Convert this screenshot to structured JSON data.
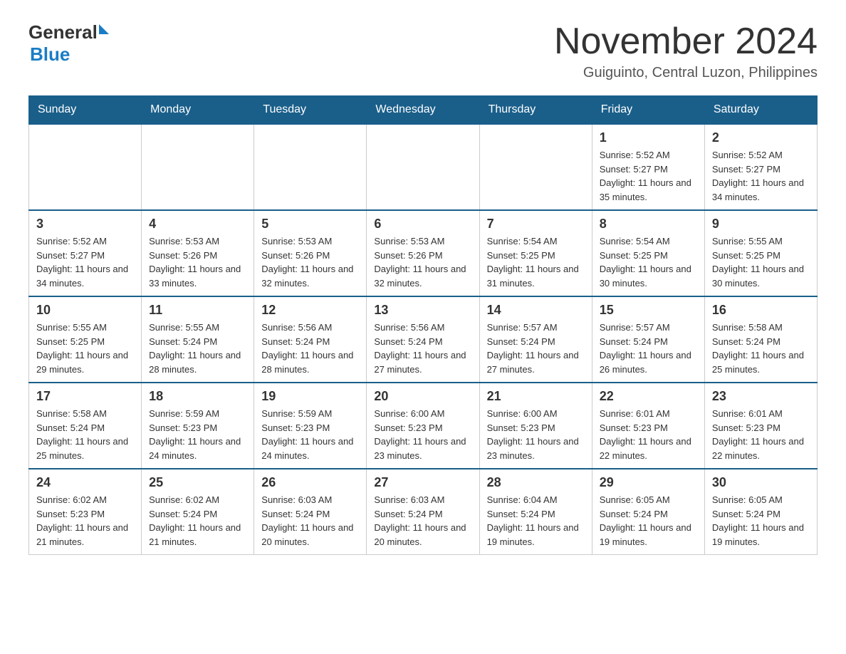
{
  "header": {
    "logo": {
      "general": "General",
      "blue": "Blue",
      "alt": "GeneralBlue logo"
    },
    "title": "November 2024",
    "location": "Guiguinto, Central Luzon, Philippines"
  },
  "calendar": {
    "days_of_week": [
      "Sunday",
      "Monday",
      "Tuesday",
      "Wednesday",
      "Thursday",
      "Friday",
      "Saturday"
    ],
    "weeks": [
      [
        {
          "day": "",
          "info": ""
        },
        {
          "day": "",
          "info": ""
        },
        {
          "day": "",
          "info": ""
        },
        {
          "day": "",
          "info": ""
        },
        {
          "day": "",
          "info": ""
        },
        {
          "day": "1",
          "info": "Sunrise: 5:52 AM\nSunset: 5:27 PM\nDaylight: 11 hours and 35 minutes."
        },
        {
          "day": "2",
          "info": "Sunrise: 5:52 AM\nSunset: 5:27 PM\nDaylight: 11 hours and 34 minutes."
        }
      ],
      [
        {
          "day": "3",
          "info": "Sunrise: 5:52 AM\nSunset: 5:27 PM\nDaylight: 11 hours and 34 minutes."
        },
        {
          "day": "4",
          "info": "Sunrise: 5:53 AM\nSunset: 5:26 PM\nDaylight: 11 hours and 33 minutes."
        },
        {
          "day": "5",
          "info": "Sunrise: 5:53 AM\nSunset: 5:26 PM\nDaylight: 11 hours and 32 minutes."
        },
        {
          "day": "6",
          "info": "Sunrise: 5:53 AM\nSunset: 5:26 PM\nDaylight: 11 hours and 32 minutes."
        },
        {
          "day": "7",
          "info": "Sunrise: 5:54 AM\nSunset: 5:25 PM\nDaylight: 11 hours and 31 minutes."
        },
        {
          "day": "8",
          "info": "Sunrise: 5:54 AM\nSunset: 5:25 PM\nDaylight: 11 hours and 30 minutes."
        },
        {
          "day": "9",
          "info": "Sunrise: 5:55 AM\nSunset: 5:25 PM\nDaylight: 11 hours and 30 minutes."
        }
      ],
      [
        {
          "day": "10",
          "info": "Sunrise: 5:55 AM\nSunset: 5:25 PM\nDaylight: 11 hours and 29 minutes."
        },
        {
          "day": "11",
          "info": "Sunrise: 5:55 AM\nSunset: 5:24 PM\nDaylight: 11 hours and 28 minutes."
        },
        {
          "day": "12",
          "info": "Sunrise: 5:56 AM\nSunset: 5:24 PM\nDaylight: 11 hours and 28 minutes."
        },
        {
          "day": "13",
          "info": "Sunrise: 5:56 AM\nSunset: 5:24 PM\nDaylight: 11 hours and 27 minutes."
        },
        {
          "day": "14",
          "info": "Sunrise: 5:57 AM\nSunset: 5:24 PM\nDaylight: 11 hours and 27 minutes."
        },
        {
          "day": "15",
          "info": "Sunrise: 5:57 AM\nSunset: 5:24 PM\nDaylight: 11 hours and 26 minutes."
        },
        {
          "day": "16",
          "info": "Sunrise: 5:58 AM\nSunset: 5:24 PM\nDaylight: 11 hours and 25 minutes."
        }
      ],
      [
        {
          "day": "17",
          "info": "Sunrise: 5:58 AM\nSunset: 5:24 PM\nDaylight: 11 hours and 25 minutes."
        },
        {
          "day": "18",
          "info": "Sunrise: 5:59 AM\nSunset: 5:23 PM\nDaylight: 11 hours and 24 minutes."
        },
        {
          "day": "19",
          "info": "Sunrise: 5:59 AM\nSunset: 5:23 PM\nDaylight: 11 hours and 24 minutes."
        },
        {
          "day": "20",
          "info": "Sunrise: 6:00 AM\nSunset: 5:23 PM\nDaylight: 11 hours and 23 minutes."
        },
        {
          "day": "21",
          "info": "Sunrise: 6:00 AM\nSunset: 5:23 PM\nDaylight: 11 hours and 23 minutes."
        },
        {
          "day": "22",
          "info": "Sunrise: 6:01 AM\nSunset: 5:23 PM\nDaylight: 11 hours and 22 minutes."
        },
        {
          "day": "23",
          "info": "Sunrise: 6:01 AM\nSunset: 5:23 PM\nDaylight: 11 hours and 22 minutes."
        }
      ],
      [
        {
          "day": "24",
          "info": "Sunrise: 6:02 AM\nSunset: 5:23 PM\nDaylight: 11 hours and 21 minutes."
        },
        {
          "day": "25",
          "info": "Sunrise: 6:02 AM\nSunset: 5:24 PM\nDaylight: 11 hours and 21 minutes."
        },
        {
          "day": "26",
          "info": "Sunrise: 6:03 AM\nSunset: 5:24 PM\nDaylight: 11 hours and 20 minutes."
        },
        {
          "day": "27",
          "info": "Sunrise: 6:03 AM\nSunset: 5:24 PM\nDaylight: 11 hours and 20 minutes."
        },
        {
          "day": "28",
          "info": "Sunrise: 6:04 AM\nSunset: 5:24 PM\nDaylight: 11 hours and 19 minutes."
        },
        {
          "day": "29",
          "info": "Sunrise: 6:05 AM\nSunset: 5:24 PM\nDaylight: 11 hours and 19 minutes."
        },
        {
          "day": "30",
          "info": "Sunrise: 6:05 AM\nSunset: 5:24 PM\nDaylight: 11 hours and 19 minutes."
        }
      ]
    ]
  }
}
